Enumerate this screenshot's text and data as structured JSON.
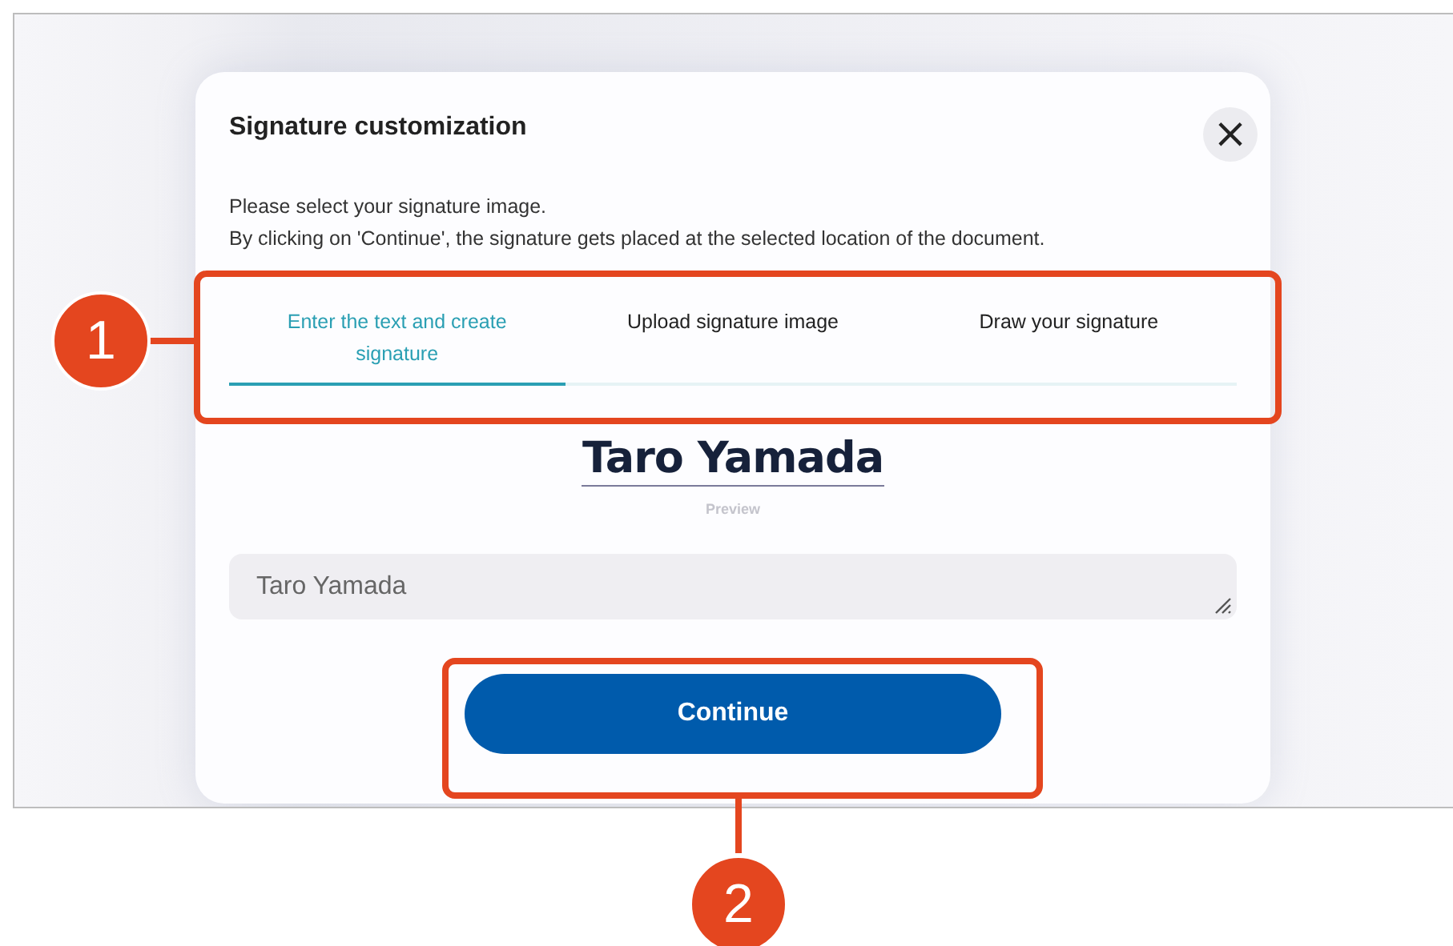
{
  "dialog": {
    "title": "Signature customization",
    "close": "×",
    "description": [
      "Please select your signature image.",
      "By clicking on 'Continue', the signature gets placed at the selected location of the document."
    ]
  },
  "tabs": [
    {
      "label": "Enter the text and create signature",
      "selected": true
    },
    {
      "label": "Upload signature image",
      "selected": false
    },
    {
      "label": "Draw your signature",
      "selected": false
    }
  ],
  "signature_preview": {
    "text": "Taro Yamada",
    "caption": "Preview"
  },
  "name_field": {
    "value": "Taro Yamada"
  },
  "continue_button": {
    "label": "Continue"
  },
  "callouts": [
    {
      "label": "1"
    },
    {
      "label": "2"
    }
  ]
}
